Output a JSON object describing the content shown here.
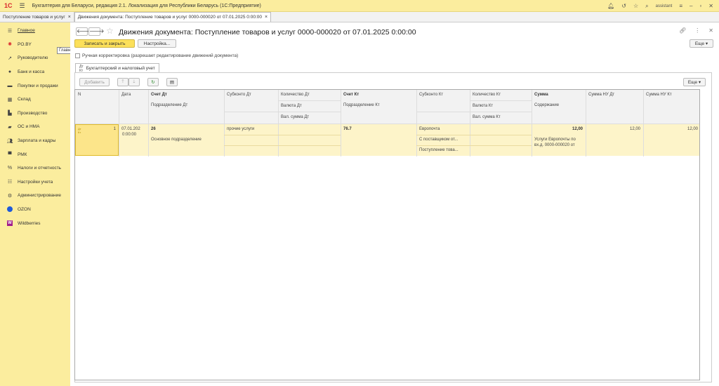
{
  "titlebar": {
    "logo": "1С",
    "title": "Бухгалтерия для Беларуси, редакция 2.1. Локализация для Республики Беларусь   (1С:Предприятие)",
    "user": "assistant"
  },
  "open_tabs": [
    {
      "label": "Поступление товаров и услуг"
    },
    {
      "label": "Движения документа: Поступление товаров и услуг 0000-000020 от 07.01.2025 0:00:00"
    }
  ],
  "sidebar": {
    "items": [
      {
        "label": "Главное",
        "icon": "menu-icon"
      },
      {
        "label": "PO.BY",
        "icon": "po-icon"
      },
      {
        "label": "Руководителю",
        "icon": "chart-icon"
      },
      {
        "label": "Банк и касса",
        "icon": "bank-icon"
      },
      {
        "label": "Покупки и продажи",
        "icon": "cart-icon"
      },
      {
        "label": "Склад",
        "icon": "warehouse-icon"
      },
      {
        "label": "Производство",
        "icon": "factory-icon"
      },
      {
        "label": "ОС и НМА",
        "icon": "truck-icon"
      },
      {
        "label": "Зарплата и кадры",
        "icon": "people-icon"
      },
      {
        "label": "РМК",
        "icon": "register-icon"
      },
      {
        "label": "Налоги и отчетность",
        "icon": "tax-icon"
      },
      {
        "label": "Настройки учета",
        "icon": "settings-list-icon"
      },
      {
        "label": "Администрирование",
        "icon": "gear-icon"
      },
      {
        "label": "OZON",
        "icon": "ozon-icon"
      },
      {
        "label": "Wildberries",
        "icon": "wildberries-icon"
      }
    ],
    "tooltip": "Главное"
  },
  "document": {
    "title": "Движения документа: Поступление товаров и услуг 0000-000020 от 07.01.2025 0:00:00",
    "save_close_label": "Записать и закрыть",
    "settings_label": "Настройка...",
    "more_label": "Еще ▾",
    "manual_adjust_label": "Ручная корректировка (разрешает редактирование движений документа)",
    "tab_label": "Бухгалтерский и налоговый учет",
    "add_label": "Добавить",
    "table_more_label": "Еще ▾"
  },
  "table": {
    "headers": {
      "n": "N",
      "date": "Дата",
      "account_dt": "Счет Дт",
      "division_dt": "Подразделение Дт",
      "subconto_dt": "Субконто Дт",
      "qty_dt": "Количество Дт",
      "currency_dt": "Валюта Дт",
      "cur_sum_dt": "Вал. сумма Дт",
      "account_kt": "Счет Кт",
      "division_kt": "Подразделение Кт",
      "subconto_kt": "Субконто Кт",
      "qty_kt": "Количество Кт",
      "currency_kt": "Валюта Кт",
      "cur_sum_kt": "Вал. сумма Кт",
      "sum": "Сумма",
      "content": "Содержание",
      "sum_nu_dt": "Сумма НУ Дт",
      "sum_nu_kt": "Сумма НУ Кт"
    },
    "row": {
      "n": "1",
      "date_1": "07.01.202",
      "date_2": "0:00:00",
      "account_dt": "26",
      "division_dt": "Основное подразделение",
      "subconto_dt": "прочие услуги",
      "account_kt": "76.7",
      "subconto_kt_1": "Европочта",
      "subconto_kt_2": "С поставщиком от...",
      "subconto_kt_3": "Поступление това...",
      "sum": "12,00",
      "content_1": "Услуги Европочты по",
      "content_2": "вх.д. 0000-000020 от",
      "sum_nu_dt": "12,00",
      "sum_nu_kt": "12,00"
    }
  }
}
